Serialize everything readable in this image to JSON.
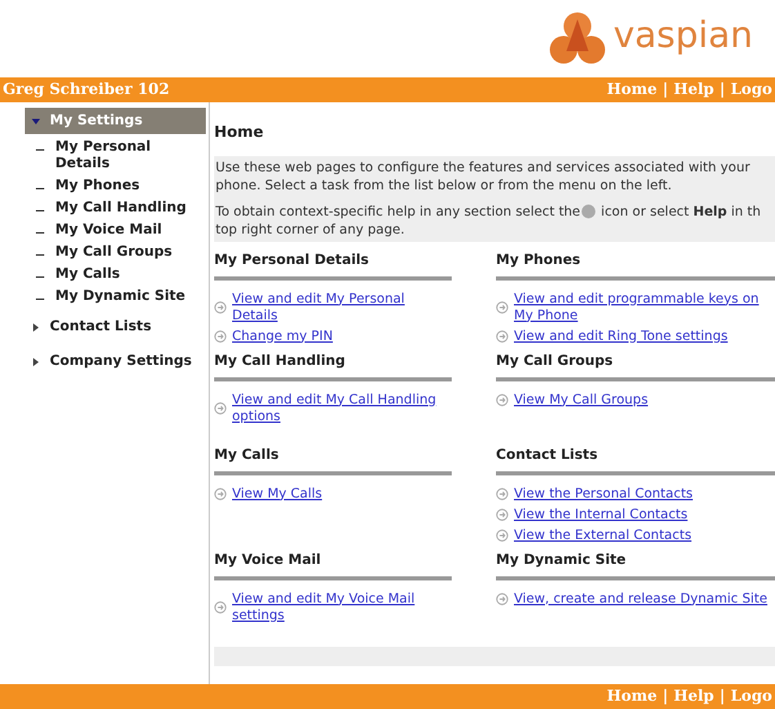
{
  "logo": {
    "text": "vaspian"
  },
  "header": {
    "user": "Greg Schreiber 102",
    "links": [
      "Home",
      "Help",
      "Logo"
    ],
    "separator": "|"
  },
  "sidebar": {
    "items": [
      {
        "label": "My Settings",
        "selected": true,
        "expanded": true,
        "children": [
          {
            "label": "My Personal Details"
          },
          {
            "label": "My Phones"
          },
          {
            "label": "My Call Handling"
          },
          {
            "label": "My Voice Mail"
          },
          {
            "label": "My Call Groups"
          },
          {
            "label": "My Calls"
          },
          {
            "label": "My Dynamic Site"
          }
        ]
      },
      {
        "label": "Contact Lists",
        "selected": false,
        "expanded": false
      },
      {
        "label": "Company Settings",
        "selected": false,
        "expanded": false
      }
    ]
  },
  "content": {
    "title": "Home",
    "intro": "Use these web pages to configure the features and services associated with your phone. Select a task from the list below or from the menu on the left.",
    "help_before": "To obtain context-specific help in any section select the",
    "help_after": " icon or select **Help** in th top right corner of any page.",
    "sections": [
      {
        "title": "My Personal Details",
        "links": [
          "View and edit My Personal Details",
          "Change my PIN"
        ]
      },
      {
        "title": "My Phones",
        "links": [
          "View and edit programmable keys on My Phone",
          "View and edit Ring Tone settings"
        ]
      },
      {
        "title": "My Call Handling",
        "links": [
          "View and edit My Call Handling options"
        ]
      },
      {
        "title": "My Call Groups",
        "links": [
          "View My Call Groups"
        ]
      },
      {
        "title": "My Calls",
        "links": [
          "View My Calls"
        ]
      },
      {
        "title": "Contact Lists",
        "links": [
          "View the Personal Contacts",
          "View the Internal Contacts",
          "View the External Contacts"
        ]
      },
      {
        "title": "My Voice Mail",
        "links": [
          "View and edit My Voice Mail settings"
        ]
      },
      {
        "title": "My Dynamic Site",
        "links": [
          "View, create and release Dynamic Site"
        ]
      }
    ]
  },
  "footer": {
    "links": [
      "Home",
      "Help",
      "Logo"
    ],
    "separator": "|"
  }
}
